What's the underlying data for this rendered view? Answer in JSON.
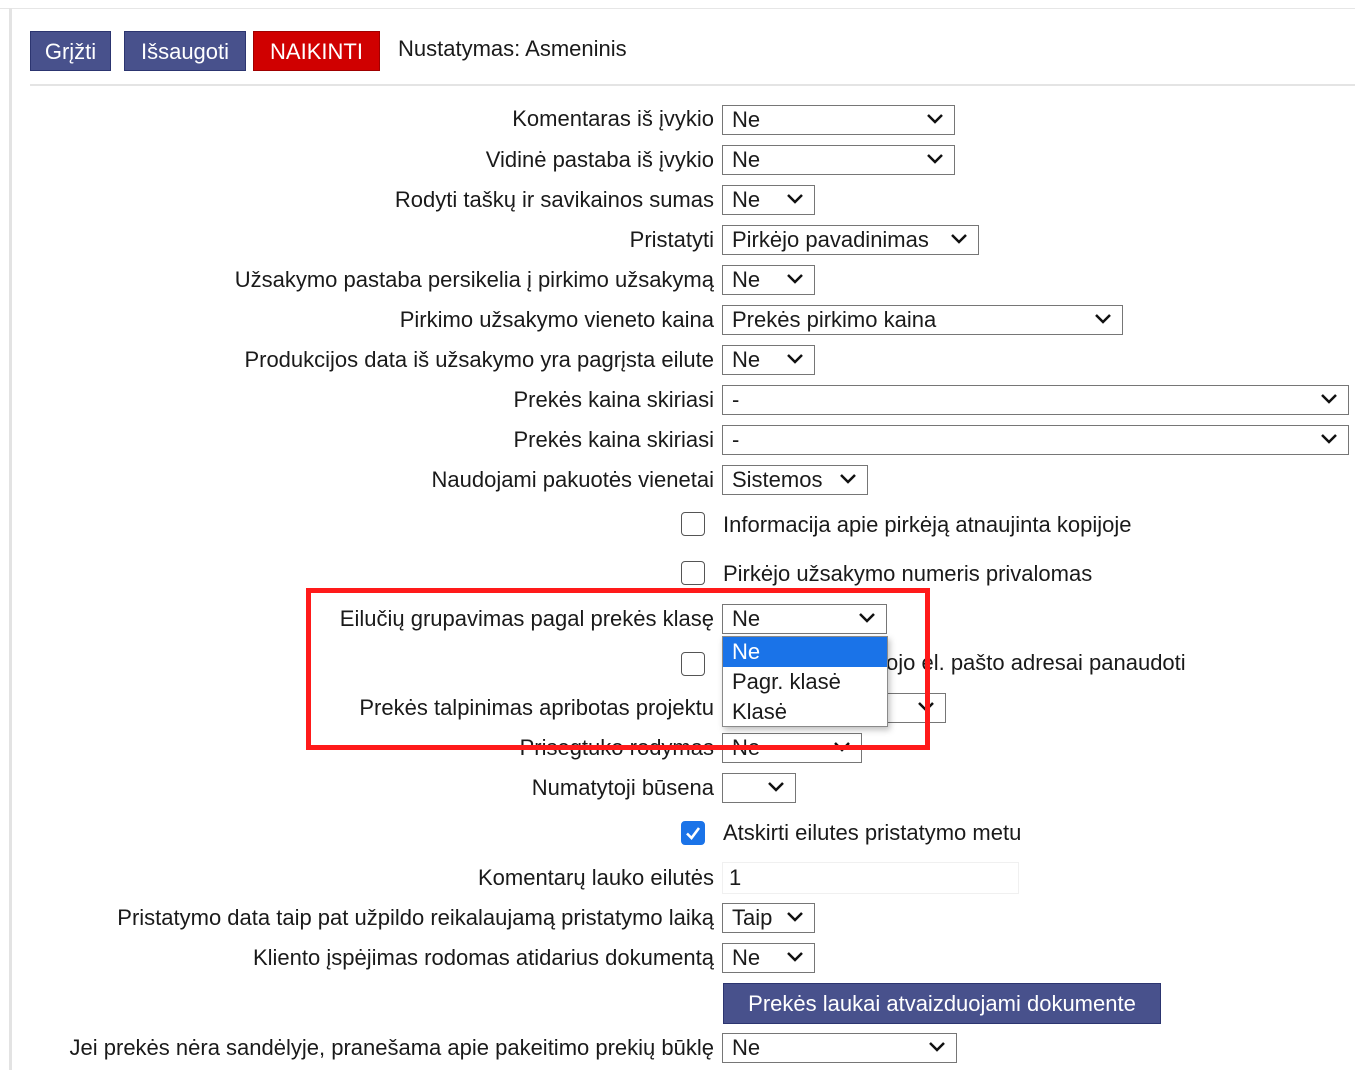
{
  "toolbar": {
    "back_label": "Grįžti",
    "save_label": "Išsaugoti",
    "delete_label": "NAIKINTI",
    "setting_title": "Nustatymas: Asmeninis"
  },
  "rows": [
    {
      "label": "Komentaras iš įvykio",
      "value": "Ne"
    },
    {
      "label": "Vidinė pastaba iš įvykio",
      "value": "Ne"
    },
    {
      "label": "Rodyti taškų ir savikainos sumas",
      "value": "Ne"
    },
    {
      "label": "Pristatyti",
      "value": "Pirkėjo pavadinimas"
    },
    {
      "label": "Užsakymo pastaba persikelia į pirkimo užsakymą",
      "value": "Ne"
    },
    {
      "label": "Pirkimo užsakymo vieneto kaina",
      "value": "Prekės pirkimo kaina"
    },
    {
      "label": "Produkcijos data iš užsakymo yra pagrįsta eilute",
      "value": "Ne"
    },
    {
      "label": "Prekės kaina skiriasi",
      "value": "-"
    },
    {
      "label": "Prekės kaina skiriasi",
      "value": "-"
    },
    {
      "label": "Naudojami pakuotės vienetai",
      "value": "Sistemos"
    },
    {
      "label": "Eilučių grupavimas pagal prekės klasę",
      "value": "Ne"
    },
    {
      "label": "Prekės talpinimas apribotas projektu",
      "value": ""
    },
    {
      "label": "Prisegtuko rodymas",
      "value": "Ne"
    },
    {
      "label": "Numatytoji būsena",
      "value": ""
    },
    {
      "label": "Komentarų lauko eilutės",
      "value": "1"
    },
    {
      "label": "Pristatymo data taip pat užpildo reikalaujamą pristatymo laiką",
      "value": "Taip"
    },
    {
      "label": "Kliento įspėjimas rodomas atidarius dokumentą",
      "value": "Ne"
    },
    {
      "label": "Jei prekės nėra sandėlyje, pranešama apie pakeitimo prekių būklę",
      "value": "Ne"
    }
  ],
  "checkboxes": [
    {
      "label": "Informacija apie pirkėją atnaujinta kopijoje",
      "checked": false
    },
    {
      "label": "Pirkėjo užsakymo numeris privalomas",
      "checked": false
    },
    {
      "label": "ojo el. pašto adresai panaudoti",
      "checked": false
    },
    {
      "label": "Atskirti eilutes pristatymo metu",
      "checked": true
    }
  ],
  "dropdown": {
    "options": [
      "Ne",
      "Pagr. klasė",
      "Klasė"
    ],
    "selected": "Ne"
  },
  "fields_button_label": "Prekės laukai atvaizduojami dokumente",
  "colors": {
    "accent": "#48518c",
    "danger": "#d00000",
    "highlight": "#ff1a1a",
    "select_blue": "#1a73e8"
  }
}
